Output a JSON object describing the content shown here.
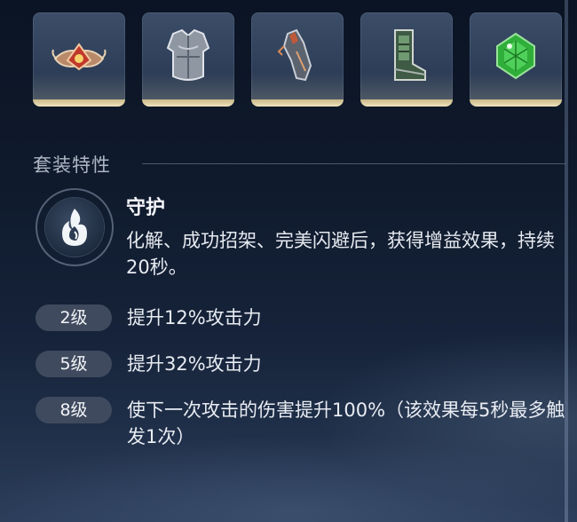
{
  "equipment": {
    "slots": [
      {
        "icon": "helmet-crown-icon"
      },
      {
        "icon": "chest-armor-icon"
      },
      {
        "icon": "gauntlet-icon"
      },
      {
        "icon": "boots-icon"
      },
      {
        "icon": "green-gem-icon"
      }
    ]
  },
  "set_bonus": {
    "section_title": "套装特性",
    "skill": {
      "icon": "flame-guard-icon",
      "name": "守护",
      "description": "化解、成功招架、完美闪避后，获得增益效果，持续20秒。"
    },
    "levels": [
      {
        "label": "2级",
        "effect": "提升12%攻击力"
      },
      {
        "label": "5级",
        "effect": "提升32%攻击力"
      },
      {
        "label": "8级",
        "effect": "使下一次攻击的伤害提升100%（该效果每5秒最多触发1次）"
      }
    ]
  },
  "colors": {
    "slot_accent": "#efe2bb",
    "pill_bg": "#3f4a5e",
    "background": "#0f1a2c"
  }
}
